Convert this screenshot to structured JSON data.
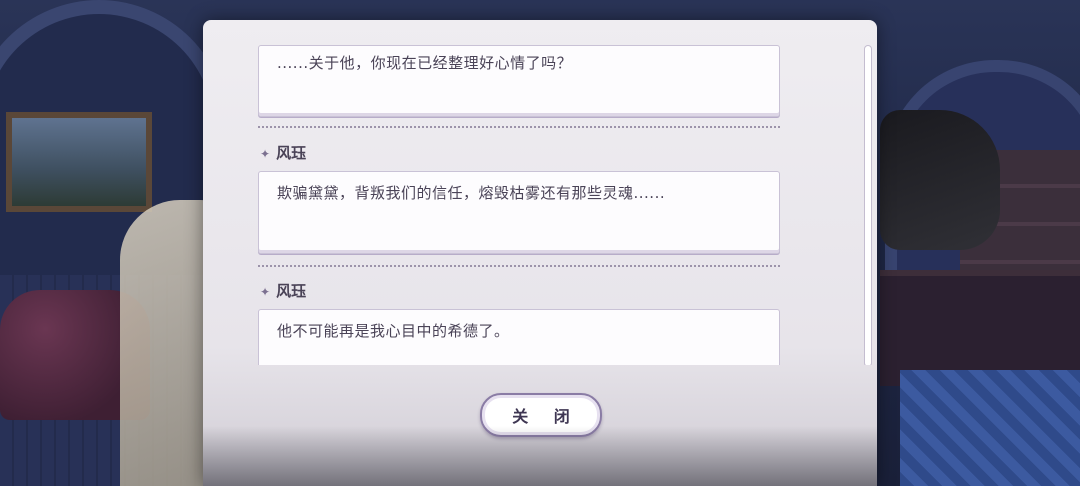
{
  "dialog": {
    "entries": [
      {
        "speaker": "",
        "text": "......关于他，你现在已经整理好心情了吗？"
      },
      {
        "speaker": "风珏",
        "text": "欺骗黛黛，背叛我们的信任，熔毁枯雾还有那些灵魂......"
      },
      {
        "speaker": "风珏",
        "text": "他不可能再是我心目中的希德了。"
      }
    ],
    "speaker_icon": "sparkle-icon",
    "close_label": "关 闭"
  },
  "colors": {
    "panel": "#efedf1",
    "text": "#4a4357",
    "accent": "#8a7ca5"
  }
}
